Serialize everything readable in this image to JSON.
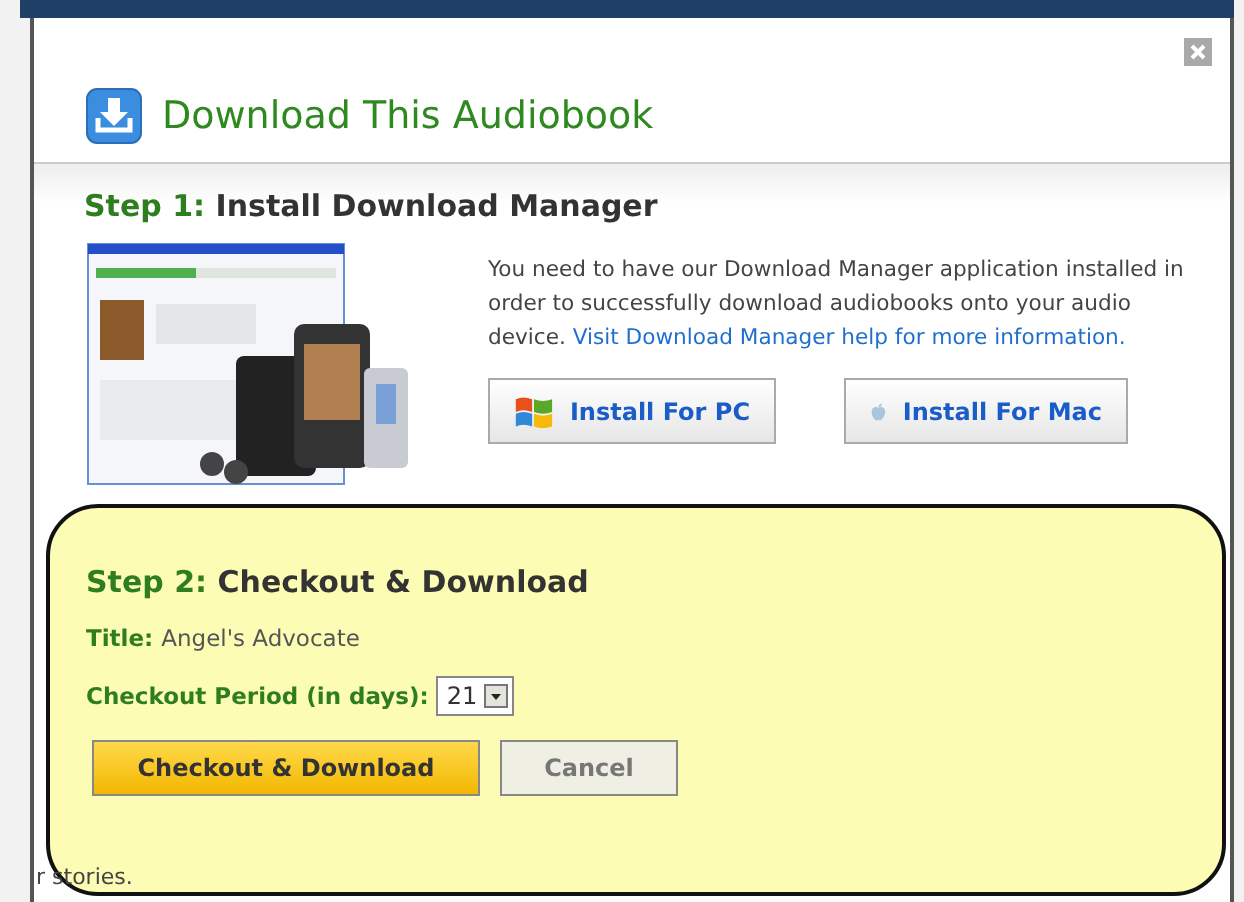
{
  "dialog": {
    "title": "Download This Audiobook"
  },
  "step1": {
    "label": "Step 1:",
    "heading": "Install Download Manager",
    "description": "You need to have our Download Manager application installed in order to successfully download audiobooks onto your audio device.",
    "link": "Visit Download Manager help for more information.",
    "buttons": [
      {
        "label": "Install For PC",
        "kind": "windows"
      },
      {
        "label": "Install For Mac",
        "kind": "apple"
      }
    ]
  },
  "step2": {
    "label": "Step 2:",
    "heading": "Checkout & Download",
    "title_label": "Title:",
    "title_value": "Angel's Advocate",
    "period_label": "Checkout Period (in days):",
    "period_value": "21",
    "buttons": [
      {
        "label": "Checkout & Download",
        "kind": "primary"
      },
      {
        "label": "Cancel",
        "kind": "secondary"
      }
    ]
  },
  "background_text": "r stories."
}
